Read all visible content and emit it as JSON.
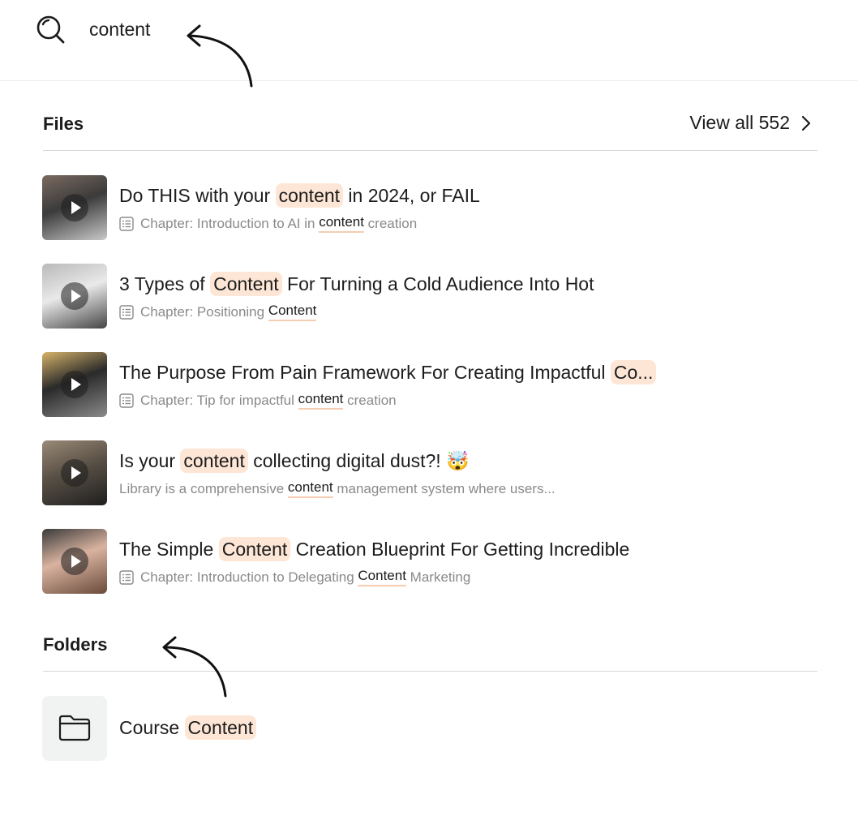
{
  "search": {
    "query": "content",
    "placeholder": ""
  },
  "files_section": {
    "title": "Files",
    "view_all_label": "View all 552"
  },
  "files": [
    {
      "title_before": "Do THIS with your ",
      "title_highlight": "content",
      "title_after": " in 2024, or FAIL",
      "sub_icon": "list-icon",
      "sub_before": "Chapter: Introduction to AI in ",
      "sub_match": "content",
      "sub_after": " creation"
    },
    {
      "title_before": "3 Types of ",
      "title_highlight": "Content",
      "title_after": " For Turning a Cold Audience Into Hot",
      "sub_icon": "list-icon",
      "sub_before": "Chapter: Positioning ",
      "sub_match": "Content",
      "sub_after": ""
    },
    {
      "title_before": "The Purpose From Pain Framework For Creating Impactful ",
      "title_highlight": "Co...",
      "title_after": "",
      "sub_icon": "list-icon",
      "sub_before": "Chapter: Tip for impactful ",
      "sub_match": "content",
      "sub_after": " creation"
    },
    {
      "title_before": "Is your ",
      "title_highlight": "content",
      "title_after": " collecting digital dust?! 🤯",
      "sub_icon": "",
      "sub_before": "Library is a comprehensive ",
      "sub_match": "content",
      "sub_after": " management system where users..."
    },
    {
      "title_before": "The Simple ",
      "title_highlight": "Content",
      "title_after": " Creation Blueprint For Getting Incredible",
      "sub_icon": "list-icon",
      "sub_before": "Chapter: Introduction to Delegating ",
      "sub_match": "Content",
      "sub_after": " Marketing"
    }
  ],
  "folders_section": {
    "title": "Folders"
  },
  "folders": [
    {
      "name_before": "Course ",
      "name_highlight": "Content",
      "icon": "folder-icon"
    }
  ],
  "colors": {
    "highlight": "#fde6d6",
    "underline": "#f6cdb3",
    "muted_text": "#8a8a8a"
  }
}
